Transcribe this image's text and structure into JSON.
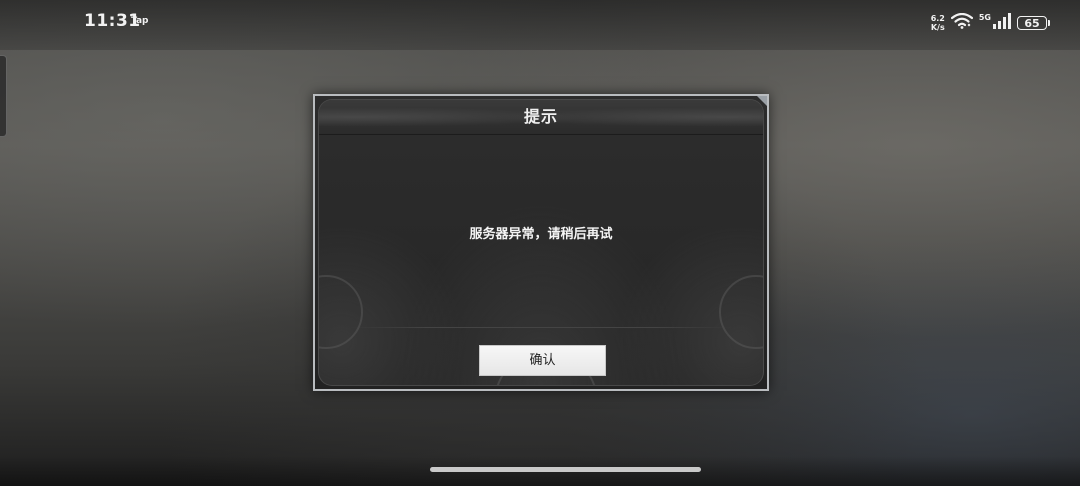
{
  "status_bar": {
    "time": "11:31",
    "app_label": "Tap",
    "net_speed_value": "6.2",
    "net_speed_unit": "K/s",
    "network_type": "5G",
    "battery_level": "65",
    "icons": [
      "wifi-icon",
      "cellular-signal-icon",
      "battery-icon"
    ]
  },
  "dialog": {
    "title": "提示",
    "message": "服务器异常，请稍后再试",
    "confirm_label": "确认"
  },
  "colors": {
    "dialog_border": "#b9bcbf",
    "dialog_background": "#262626",
    "button_background": "#f2f2f2",
    "text_light": "#f0f0f0"
  }
}
